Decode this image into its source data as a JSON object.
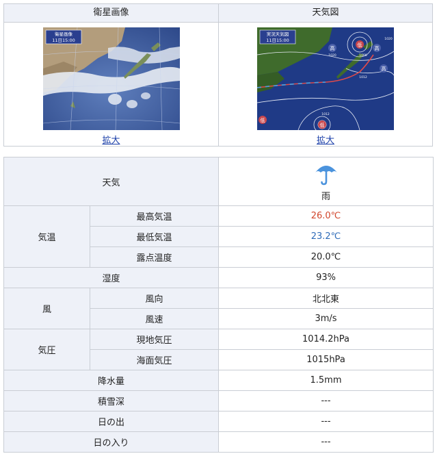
{
  "images": {
    "satellite": {
      "header": "衛星画像",
      "overlay_title": "衛星画像",
      "overlay_time": "11日15:00",
      "zoom_label": "拡大"
    },
    "weather_map": {
      "header": "天気図",
      "overlay_title": "実況天気図",
      "overlay_time": "11日15:00",
      "zoom_label": "拡大",
      "map_labels": [
        "高",
        "高",
        "高",
        "低",
        "低",
        "低"
      ],
      "isobar_labels": [
        "1020",
        "1000",
        "1012",
        "1020",
        "1012"
      ]
    }
  },
  "table": {
    "weather": {
      "label": "天気",
      "icon": "umbrella-icon",
      "value": "雨"
    },
    "temperature": {
      "label": "気温",
      "max": {
        "label": "最高気温",
        "value": "26.0℃",
        "color": "#d1462c"
      },
      "min": {
        "label": "最低気温",
        "value": "23.2℃",
        "color": "#2e6bb8"
      },
      "dew": {
        "label": "露点温度",
        "value": "20.0℃"
      }
    },
    "humidity": {
      "label": "湿度",
      "value": "93%"
    },
    "wind": {
      "label": "風",
      "direction": {
        "label": "風向",
        "value": "北北東"
      },
      "speed": {
        "label": "風速",
        "value": "3m/s"
      }
    },
    "pressure": {
      "label": "気圧",
      "station": {
        "label": "現地気圧",
        "value": "1014.2hPa"
      },
      "sea": {
        "label": "海面気圧",
        "value": "1015hPa"
      }
    },
    "precip": {
      "label": "降水量",
      "value": "1.5mm"
    },
    "snow": {
      "label": "積雪深",
      "value": "---"
    },
    "sunrise": {
      "label": "日の出",
      "value": "---"
    },
    "sunset": {
      "label": "日の入り",
      "value": "---"
    }
  }
}
